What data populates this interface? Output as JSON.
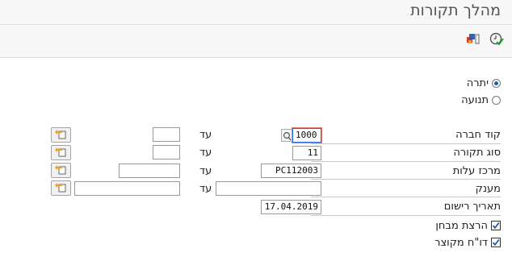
{
  "window": {
    "title": "מהלך תקורות"
  },
  "toolbar": {
    "icon1": "copy-layout-icon",
    "icon2": "execute-clock-icon"
  },
  "selection": {
    "options": [
      {
        "label": "יתרה",
        "selected": true
      },
      {
        "label": "תנועה",
        "selected": false
      }
    ]
  },
  "fields": {
    "company_code": {
      "label": "קוד חברה",
      "value": "1000",
      "to_label": "עד",
      "to_value": ""
    },
    "overhead_type": {
      "label": "סוג תקורה",
      "value": "11",
      "to_label": "עד",
      "to_value": ""
    },
    "cost_center": {
      "label": "מרכז עלות",
      "value": "PC112003",
      "to_label": "עד",
      "to_value": ""
    },
    "grant": {
      "label": "מענק",
      "value": "",
      "to_label": "עד",
      "to_value": ""
    },
    "posting_date": {
      "label": "תאריך רישום",
      "value": "17.04.2019"
    }
  },
  "checks": [
    {
      "label": "הרצת מבחן",
      "checked": true
    },
    {
      "label": "דו\"ח מקוצר",
      "checked": true
    }
  ],
  "colors": {
    "accent": "#1f5fa6",
    "focus_border": "#2b6cd6",
    "multi_arrow": "#e8a02b"
  }
}
